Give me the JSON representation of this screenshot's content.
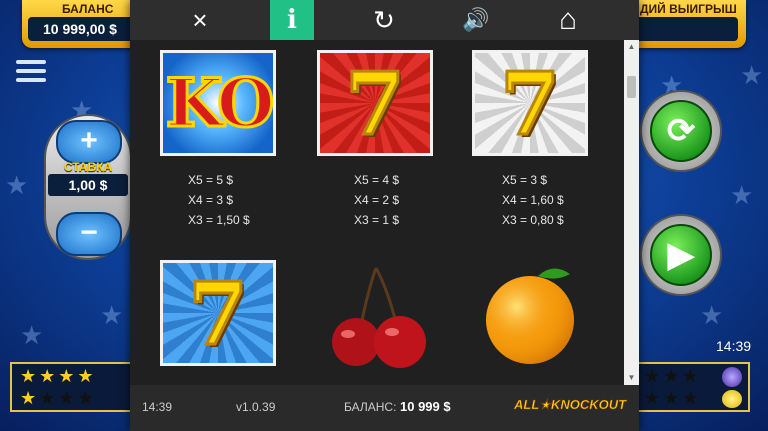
{
  "colors": {
    "accent": "#21c087",
    "gold": "#ffcf1a",
    "panel": "#202020"
  },
  "game": {
    "balance_label": "БАЛАНС",
    "balance_value": "10 999,00 $",
    "win_label": "ДИЙ ВЫИГРЫШ",
    "bet_label": "СТАВКА",
    "bet_value": "1,00 $",
    "bet_plus_icon": "plus-icon",
    "bet_minus_icon": "minus-icon",
    "time": "14:39",
    "menu_icon": "hamburger-menu-icon",
    "spin_icon": "refresh-icon",
    "autoplay_icon": "play-icon"
  },
  "topbar": {
    "close_icon": "×",
    "info_icon": "i",
    "refresh_icon": "↻",
    "sound_icon": "🔊",
    "home_icon": "⌂"
  },
  "symbols": [
    {
      "name": "ko",
      "text": "KO",
      "payouts": [
        "X5 = 5 $",
        "X4 = 3 $",
        "X3 = 1,50 $"
      ]
    },
    {
      "name": "seven-red",
      "text": "7",
      "payouts": [
        "X5 = 4 $",
        "X4 = 2 $",
        "X3 = 1 $"
      ]
    },
    {
      "name": "seven-silver",
      "text": "7",
      "payouts": [
        "X5 = 3 $",
        "X4 = 1,60 $",
        "X3 = 0,80 $"
      ]
    },
    {
      "name": "seven-blue",
      "text": "7"
    },
    {
      "name": "cherry",
      "text": ""
    },
    {
      "name": "orange",
      "text": ""
    }
  ],
  "footer": {
    "time": "14:39",
    "version": "v1.0.39",
    "balance_label": "БАЛАНС:",
    "balance_value": "10 999 $",
    "logo": "ALL★KNOCKOUT"
  }
}
